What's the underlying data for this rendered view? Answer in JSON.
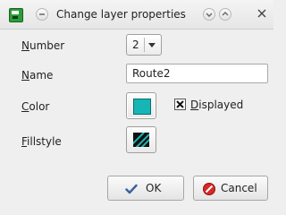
{
  "window": {
    "title": "Change layer properties"
  },
  "form": {
    "number": {
      "label_mnemonic": "N",
      "label_rest": "umber",
      "value": "2"
    },
    "name": {
      "label_mnemonic": "N",
      "label_rest": "ame",
      "value": "Route2"
    },
    "color": {
      "label_mnemonic": "C",
      "label_rest": "olor",
      "swatch": "#16b6b6"
    },
    "displayed": {
      "label_mnemonic": "D",
      "label_rest": "isplayed",
      "checked": true
    },
    "fillstyle": {
      "label_mnemonic": "F",
      "label_rest": "illstyle"
    }
  },
  "buttons": {
    "ok": "OK",
    "cancel": "Cancel"
  },
  "icons": {
    "app": "app-icon",
    "menu": "window-menu-icon",
    "minimize": "chevron-down-icon",
    "maximize": "chevron-up-icon",
    "close": "close-icon",
    "ok": "checkmark-icon",
    "cancel": "cancel-icon"
  }
}
